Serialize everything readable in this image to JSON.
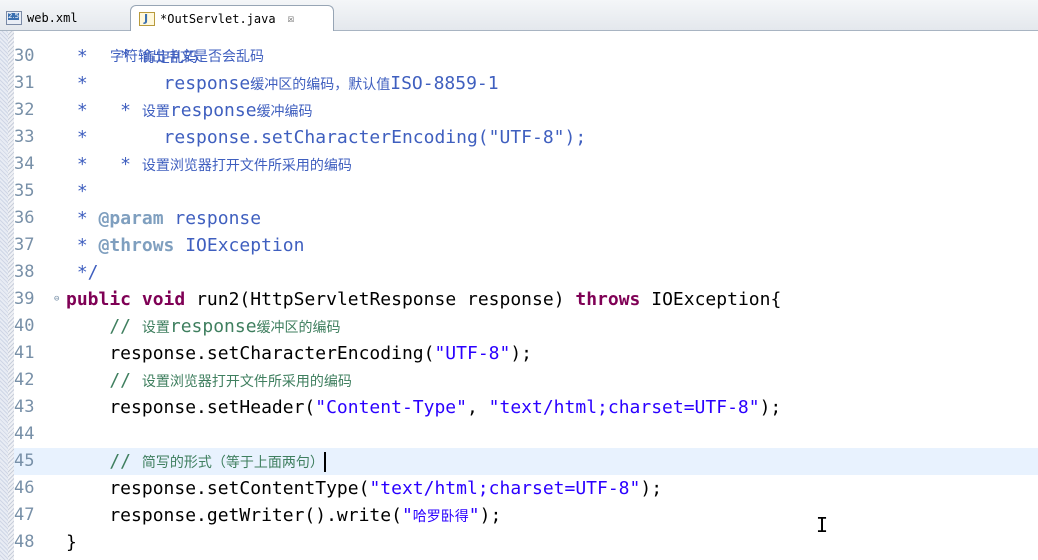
{
  "tabs": [
    {
      "label": "web.xml",
      "icon": "xml-file-icon",
      "active": false
    },
    {
      "label": "*OutServlet.java",
      "icon": "java-file-icon",
      "active": true,
      "close": "☒"
    }
  ],
  "editor": {
    "partial_top": "字符输出中文是否会乱码",
    "lines": [
      {
        "num": "30",
        "text": " *   * 肯定乱码"
      },
      {
        "num": "31",
        "text": " *       response缓冲区的编码，默认值ISO-8859-1"
      },
      {
        "num": "32",
        "text": " *   * 设置response缓冲编码"
      },
      {
        "num": "33",
        "text": " *       response.setCharacterEncoding(\"UTF-8\");"
      },
      {
        "num": "34",
        "text": " *   * 设置浏览器打开文件所采用的编码"
      },
      {
        "num": "35",
        "text": " *"
      },
      {
        "num": "36",
        "text": " * @param response"
      },
      {
        "num": "37",
        "text": " * @throws IOException"
      },
      {
        "num": "38",
        "text": " */"
      },
      {
        "num": "39",
        "text": "public void run2(HttpServletResponse response) throws IOException{"
      },
      {
        "num": "40",
        "text": "    // 设置response缓冲区的编码"
      },
      {
        "num": "41",
        "text": "    response.setCharacterEncoding(\"UTF-8\");"
      },
      {
        "num": "42",
        "text": "    // 设置浏览器打开文件所采用的编码"
      },
      {
        "num": "43",
        "text": "    response.setHeader(\"Content-Type\", \"text/html;charset=UTF-8\");"
      },
      {
        "num": "44",
        "text": ""
      },
      {
        "num": "45",
        "text": "    // 简写的形式（等于上面两句）"
      },
      {
        "num": "46",
        "text": "    response.setContentType(\"text/html;charset=UTF-8\");"
      },
      {
        "num": "47",
        "text": "    response.getWriter().write(\"哈罗卧得\");"
      },
      {
        "num": "48",
        "text": "}"
      }
    ],
    "current_line": "45"
  }
}
